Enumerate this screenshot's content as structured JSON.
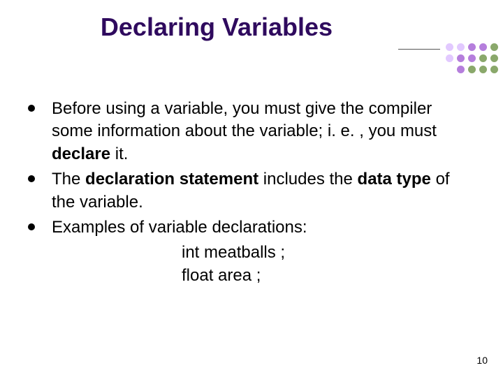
{
  "title": "Declaring Variables",
  "bullets": {
    "b0": {
      "pre": "Before using a variable, you must give the compiler some information about the variable; i. e. , you must ",
      "bold": "declare",
      "post": " it."
    },
    "b1": {
      "pre": "The ",
      "bold1": "declaration statement",
      "mid": " includes the ",
      "bold2": "data type",
      "post": " of the variable."
    },
    "b2": {
      "text": "Examples of variable declarations:"
    }
  },
  "code": {
    "line1": "int  meatballs ;",
    "line2": "float  area ;"
  },
  "pageNumber": "10",
  "dotColors": {
    "light": "#e2c9ff",
    "mid": "#b57edc",
    "green": "#8aa86b"
  }
}
